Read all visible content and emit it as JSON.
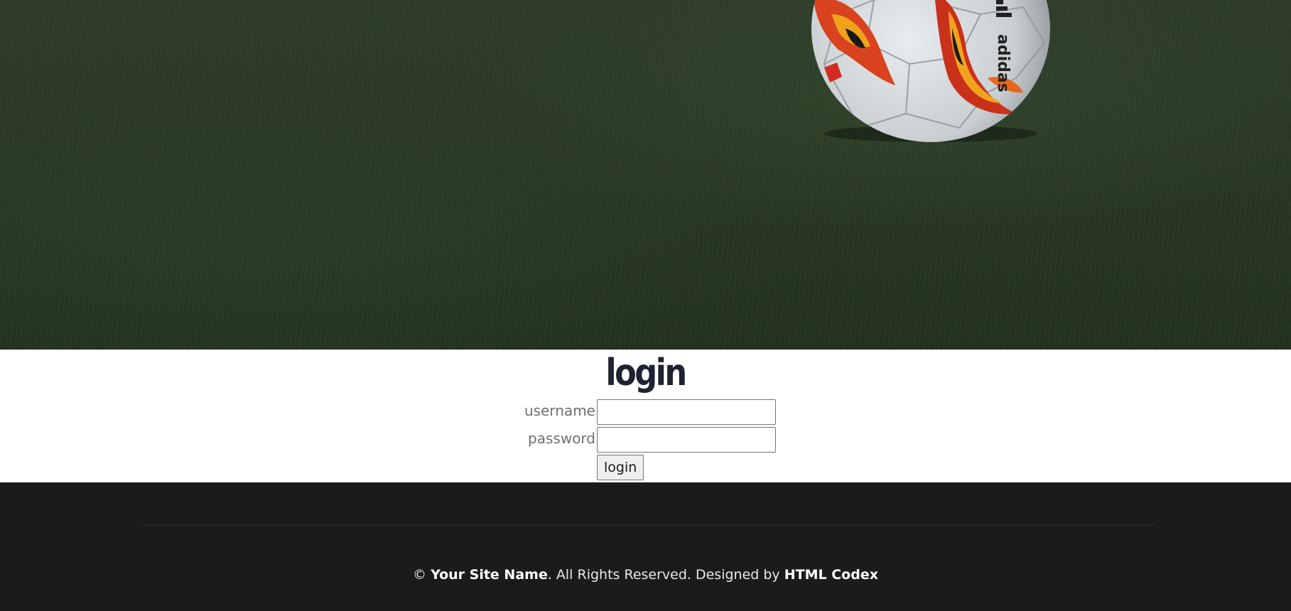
{
  "login": {
    "title": "login",
    "username_label": "username",
    "username_value": "",
    "password_label": "password",
    "password_value": "",
    "button_label": "login"
  },
  "footer": {
    "copyright_symbol": "©",
    "site_name": "Your Site Name",
    "rights_text": ". All Rights Reserved. Designed by",
    "designer": "HTML Codex"
  },
  "hero": {
    "ball_brand": "adidas",
    "icons": [
      "soccer-ball-icon"
    ]
  },
  "colors": {
    "grass": "#2e4129",
    "title": "#1f2230",
    "label": "#6c7175",
    "footer_bg": "#1b1b1b",
    "footer_text": "#e8e8e8"
  }
}
